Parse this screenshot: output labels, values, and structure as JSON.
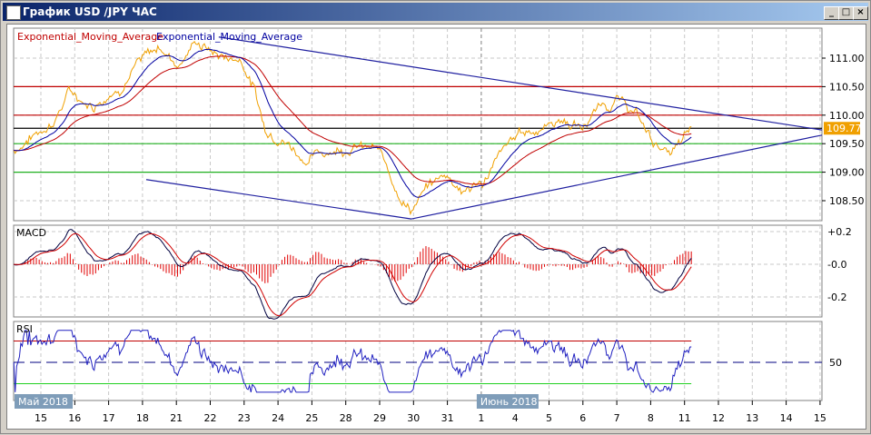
{
  "window": {
    "title": "График USD /JPY  ЧАС",
    "buttons": [
      "_",
      "□",
      "×"
    ]
  },
  "legend": [
    {
      "text": "Exponential_Moving_Average",
      "color": "#c00000"
    },
    {
      "text": "Exponential_Moving_Average",
      "color": "#0000a0"
    }
  ],
  "chart_data": [
    {
      "type": "line",
      "title": "USD/JPY H1",
      "series": [
        {
          "name": "Price",
          "color": "#f0a000",
          "points": [
            [
              -0.8,
              109.38
            ],
            [
              0.43,
              109.93
            ],
            [
              0.83,
              110.41
            ],
            [
              1.5,
              110.17
            ],
            [
              2.31,
              110.49
            ],
            [
              2.84,
              110.89
            ],
            [
              3.51,
              111.2
            ],
            [
              4.05,
              110.89
            ],
            [
              4.58,
              111.29
            ],
            [
              5.25,
              111.05
            ],
            [
              5.92,
              110.97
            ],
            [
              6.33,
              110.41
            ],
            [
              6.6,
              109.77
            ],
            [
              7.13,
              109.61
            ],
            [
              7.8,
              109.22
            ],
            [
              8.47,
              109.38
            ],
            [
              9.28,
              109.46
            ],
            [
              9.95,
              109.38
            ],
            [
              10.62,
              108.58
            ],
            [
              10.94,
              108.34
            ],
            [
              11.42,
              108.74
            ],
            [
              11.96,
              108.98
            ],
            [
              12.49,
              108.66
            ],
            [
              13.03,
              108.82
            ],
            [
              13.57,
              109.3
            ],
            [
              14.1,
              109.69
            ],
            [
              14.77,
              109.77
            ],
            [
              15.31,
              109.93
            ],
            [
              15.98,
              109.77
            ],
            [
              16.51,
              110.17
            ],
            [
              17.05,
              110.25
            ],
            [
              17.59,
              110.01
            ],
            [
              17.99,
              109.61
            ],
            [
              18.53,
              109.3
            ],
            [
              18.93,
              109.49
            ],
            [
              19.2,
              109.77
            ]
          ]
        },
        {
          "name": "Exponential_Moving_Average",
          "color": "#c00000",
          "period": 50
        },
        {
          "name": "Exponential_Moving_Average",
          "color": "#0000a0",
          "period": 20
        }
      ],
      "current_price": "109.77",
      "hlines": [
        {
          "price": 110.5,
          "color": "#c00000"
        },
        {
          "price": 110.0,
          "color": "#c00000"
        },
        {
          "price": 109.77,
          "color": "#000000"
        },
        {
          "price": 109.5,
          "color": "#20b020"
        },
        {
          "price": 109.0,
          "color": "#20b020"
        }
      ],
      "trendlines": [
        {
          "from": [
            5.25,
            111.37
          ],
          "to": [
            23.06,
            109.74
          ]
        },
        {
          "from": [
            3.11,
            108.87
          ],
          "to": [
            10.94,
            108.18
          ]
        },
        {
          "from": [
            10.94,
            108.18
          ],
          "to": [
            23.06,
            109.65
          ]
        }
      ],
      "yticks": [
        "111.00",
        "110.50",
        "110.00",
        "109.50",
        "109.00",
        "108.50"
      ],
      "ylim": [
        108.2,
        111.5
      ]
    },
    {
      "type": "line",
      "title": "MACD",
      "yticks": [
        "+0.2",
        "-0.0",
        "-0.2"
      ],
      "ylim": [
        -0.3,
        0.3
      ]
    },
    {
      "type": "line",
      "title": "RSI",
      "yticks": [
        "50"
      ],
      "levels": [
        70,
        30
      ]
    }
  ],
  "xaxis": {
    "ticks": [
      "15",
      "16",
      "17",
      "18",
      "21",
      "22",
      "23",
      "24",
      "25",
      "28",
      "29",
      "30",
      "31",
      "1",
      "4",
      "5",
      "6",
      "7",
      "8",
      "11",
      "12",
      "13",
      "14",
      "15"
    ],
    "month_labels": [
      {
        "text": "Май 2018",
        "at": -0.8
      },
      {
        "text": "Июнь 2018",
        "at": 13
      }
    ]
  }
}
